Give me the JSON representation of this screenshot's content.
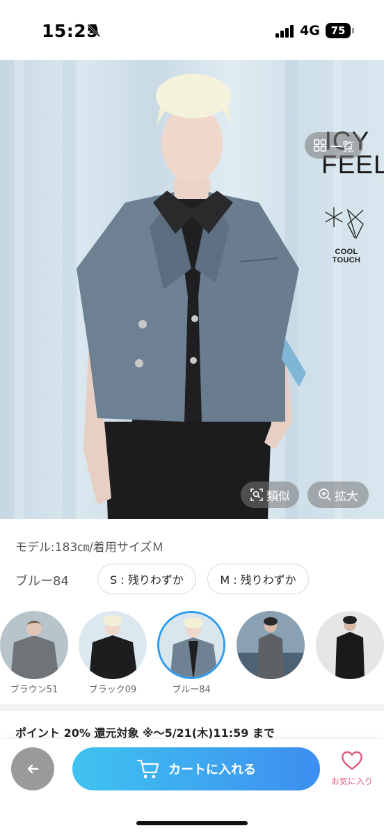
{
  "status_bar": {
    "time": "15:25",
    "network": "4G",
    "battery": "75"
  },
  "hero": {
    "brand_lines": [
      "ICY",
      "FEEL"
    ],
    "badge_text": "COOL TOUCH",
    "list_button": "一覧",
    "similar_button": "類似",
    "zoom_button": "拡大"
  },
  "product": {
    "model_info": "モデル:183㎝/着用サイズＭ",
    "color_name": "ブルー84",
    "sizes": [
      {
        "label": "S : 残りわずか"
      },
      {
        "label": "M : 残りわずか"
      }
    ]
  },
  "swatches": [
    {
      "label": "ブラウン51",
      "color": "#6f7479"
    },
    {
      "label": "ブラック09",
      "color": "#1d1d1f"
    },
    {
      "label": "ブルー84",
      "color": "#6f8294",
      "selected": true
    },
    {
      "label": "",
      "color": "#5d6166"
    },
    {
      "label": "",
      "color": "#1a1a1a"
    }
  ],
  "points_text": "ポイント 20% 還元対象 ※～5/21(木)11:59 まで",
  "bottom_bar": {
    "cart_label": "カートに入れる",
    "favorite_label": "お気に入り"
  },
  "colors": {
    "accent_start": "#3fc3f0",
    "accent_end": "#3d8ef0",
    "favorite": "#e05a7c"
  }
}
